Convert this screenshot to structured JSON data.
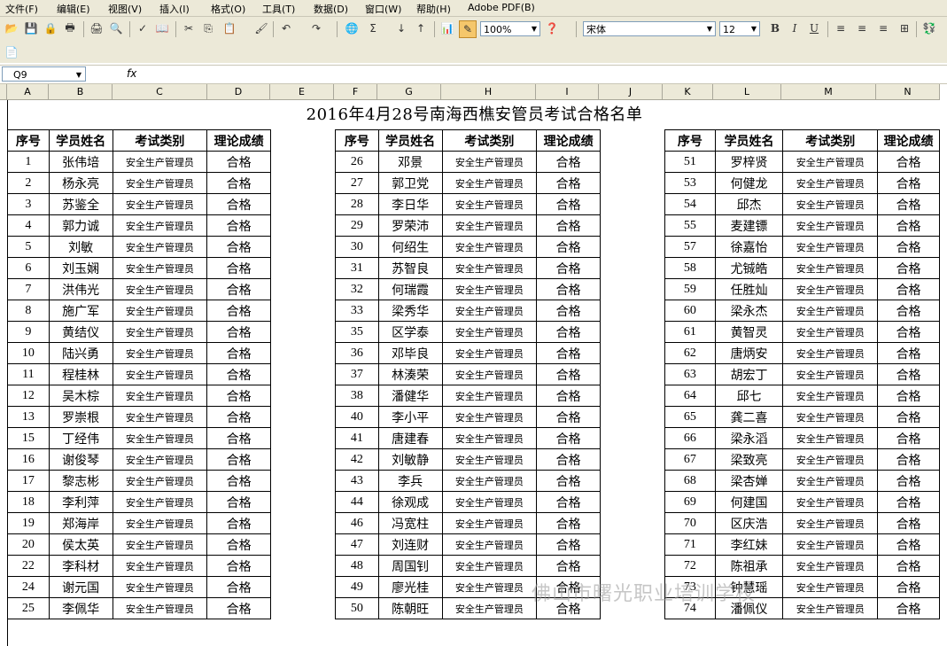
{
  "menu": {
    "items": [
      "文件(F)",
      "编辑(E)",
      "视图(V)",
      "插入(I)",
      "格式(O)",
      "工具(T)",
      "数据(D)",
      "窗口(W)",
      "帮助(H)",
      "Adobe PDF(B)"
    ]
  },
  "toolbar": {
    "zoom": "100%",
    "font_name": "宋体",
    "font_size": "12",
    "bold": "B",
    "italic": "I",
    "underline": "U",
    "sigma": "Σ"
  },
  "formula_bar": {
    "name_box": "Q9",
    "fx": "fx",
    "formula": ""
  },
  "columns": [
    "A",
    "B",
    "C",
    "D",
    "E",
    "F",
    "G",
    "H",
    "I",
    "J",
    "K",
    "L",
    "M",
    "N"
  ],
  "sheet": {
    "title": "2016年4月28号南海西樵安管员考试合格名单",
    "headers": [
      "序号",
      "学员姓名",
      "考试类别",
      "理论成绩"
    ],
    "exam_type": "安全生产管理员",
    "result": "合格",
    "group1": [
      {
        "no": "1",
        "name": "张伟培"
      },
      {
        "no": "2",
        "name": "杨永亮"
      },
      {
        "no": "3",
        "name": "苏鉴全"
      },
      {
        "no": "4",
        "name": "郭力诚"
      },
      {
        "no": "5",
        "name": "刘敏"
      },
      {
        "no": "6",
        "name": "刘玉娴"
      },
      {
        "no": "7",
        "name": "洪伟光"
      },
      {
        "no": "8",
        "name": "施广军"
      },
      {
        "no": "9",
        "name": "黄结仪"
      },
      {
        "no": "10",
        "name": "陆兴勇"
      },
      {
        "no": "11",
        "name": "程桂林"
      },
      {
        "no": "12",
        "name": "吴木棕"
      },
      {
        "no": "13",
        "name": "罗崇根"
      },
      {
        "no": "15",
        "name": "丁经伟"
      },
      {
        "no": "16",
        "name": "谢俊琴"
      },
      {
        "no": "17",
        "name": "黎志彬"
      },
      {
        "no": "18",
        "name": "李利萍"
      },
      {
        "no": "19",
        "name": "郑海岸"
      },
      {
        "no": "20",
        "name": "侯太英"
      },
      {
        "no": "22",
        "name": "李科材"
      },
      {
        "no": "24",
        "name": "谢元国"
      },
      {
        "no": "25",
        "name": "李佩华"
      }
    ],
    "group2": [
      {
        "no": "26",
        "name": "邓景"
      },
      {
        "no": "27",
        "name": "郭卫党"
      },
      {
        "no": "28",
        "name": "李日华"
      },
      {
        "no": "29",
        "name": "罗荣沛"
      },
      {
        "no": "30",
        "name": "何绍生"
      },
      {
        "no": "31",
        "name": "苏智良"
      },
      {
        "no": "32",
        "name": "何瑞霞"
      },
      {
        "no": "33",
        "name": "梁秀华"
      },
      {
        "no": "35",
        "name": "区学泰"
      },
      {
        "no": "36",
        "name": "邓毕良"
      },
      {
        "no": "37",
        "name": "林湊荣"
      },
      {
        "no": "38",
        "name": "潘健华"
      },
      {
        "no": "40",
        "name": "李小平"
      },
      {
        "no": "41",
        "name": "唐建春"
      },
      {
        "no": "42",
        "name": "刘敏静"
      },
      {
        "no": "43",
        "name": "李兵"
      },
      {
        "no": "44",
        "name": "徐观成"
      },
      {
        "no": "46",
        "name": "冯宽柱"
      },
      {
        "no": "47",
        "name": "刘连财"
      },
      {
        "no": "48",
        "name": "周国钊"
      },
      {
        "no": "49",
        "name": "廖光桂"
      },
      {
        "no": "50",
        "name": "陈朝旺"
      }
    ],
    "group3": [
      {
        "no": "51",
        "name": "罗梓贤"
      },
      {
        "no": "53",
        "name": "何健龙"
      },
      {
        "no": "54",
        "name": "邱杰"
      },
      {
        "no": "55",
        "name": "麦建镖"
      },
      {
        "no": "57",
        "name": "徐嘉怡"
      },
      {
        "no": "58",
        "name": "尤铖皓"
      },
      {
        "no": "59",
        "name": "任胜灿"
      },
      {
        "no": "60",
        "name": "梁永杰"
      },
      {
        "no": "61",
        "name": "黄智灵"
      },
      {
        "no": "62",
        "name": "唐炳安"
      },
      {
        "no": "63",
        "name": "胡宏丁"
      },
      {
        "no": "64",
        "name": "邱七"
      },
      {
        "no": "65",
        "name": "龚二喜"
      },
      {
        "no": "66",
        "name": "梁永滔"
      },
      {
        "no": "67",
        "name": "梁致亮"
      },
      {
        "no": "68",
        "name": "梁杏婵"
      },
      {
        "no": "69",
        "name": "何建国"
      },
      {
        "no": "70",
        "name": "区庆浩"
      },
      {
        "no": "71",
        "name": "李红妹"
      },
      {
        "no": "72",
        "name": "陈祖承"
      },
      {
        "no": "73",
        "name": "钟慧瑶"
      },
      {
        "no": "74",
        "name": "潘佩仪"
      }
    ]
  },
  "watermark": "佛山市曙光职业培训学校"
}
